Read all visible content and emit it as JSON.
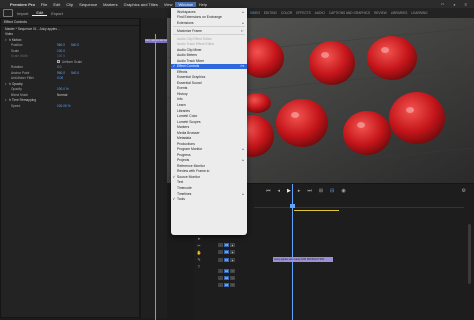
{
  "menubar": {
    "app": "Premiere Pro",
    "items": [
      "File",
      "Edit",
      "Clip",
      "Sequence",
      "Markers",
      "Graphics and Titles",
      "View",
      "Window",
      "Help"
    ],
    "active": "Window"
  },
  "workspace": {
    "tabs": [
      "Import",
      "Edit",
      "Export"
    ],
    "selected": "Edit",
    "right_tabs": [
      "VIDEO",
      "EDITING",
      "COLOR",
      "EFFECTS",
      "AUDIO",
      "CAPTIONS AND GRAPHICS",
      "REVIEW",
      "LIBRARIES",
      "LEARNING"
    ],
    "right_selected": "VIDEO"
  },
  "effect_controls": {
    "tab": "Effect Controls",
    "sequence_label": "Master * Sequence 01 - Juicy apples ...",
    "rows": [
      {
        "label": "Video",
        "value": "",
        "kind": "header"
      },
      {
        "label": "fx Motion",
        "value": "",
        "kind": "header"
      },
      {
        "label": "Position",
        "value": "960.0",
        "value2": "540.0",
        "kind": "param"
      },
      {
        "label": "Scale",
        "value": "100.0",
        "kind": "param"
      },
      {
        "label": "Scale Width",
        "value": "100.0",
        "kind": "param"
      },
      {
        "label": "",
        "value": "Uniform Scale",
        "kind": "check"
      },
      {
        "label": "Rotation",
        "value": "0.0",
        "kind": "param"
      },
      {
        "label": "Anchor Point",
        "value": "960.0",
        "value2": "540.0",
        "kind": "param"
      },
      {
        "label": "Anti-flicker Filter",
        "value": "0.00",
        "kind": "param"
      },
      {
        "label": "fx Opacity",
        "value": "",
        "kind": "header"
      },
      {
        "label": "Opacity",
        "value": "100.0 %",
        "kind": "param"
      },
      {
        "label": "Blend Mode",
        "value": "Normal",
        "kind": "param"
      },
      {
        "label": "fx Time Remapping",
        "value": "",
        "kind": "header"
      },
      {
        "label": "Speed",
        "value": "100.00 %",
        "kind": "param"
      }
    ],
    "clip_name": "Juicy apples are ready..."
  },
  "window_menu": {
    "items": [
      {
        "label": "Workspaces",
        "arrow": true
      },
      {
        "label": "Find Extensions on Exchange"
      },
      {
        "label": "Extensions",
        "arrow": true
      },
      {
        "sep": true
      },
      {
        "label": "Maximize Frame",
        "shortcut": "⇧`"
      },
      {
        "sep": true
      },
      {
        "label": "Audio Clip Effect Editor",
        "disabled": true
      },
      {
        "label": "Audio Track Effect Editor",
        "disabled": true
      },
      {
        "label": "Audio Clip Mixer"
      },
      {
        "label": "Audio Meters"
      },
      {
        "label": "Audio Track Mixer"
      },
      {
        "label": "Effect Controls",
        "checked": true,
        "highlighted": true,
        "shortcut": "⇧5"
      },
      {
        "label": "Effects"
      },
      {
        "label": "Essential Graphics"
      },
      {
        "label": "Essential Sound"
      },
      {
        "label": "Events"
      },
      {
        "label": "History"
      },
      {
        "label": "Info"
      },
      {
        "label": "Learn"
      },
      {
        "label": "Libraries"
      },
      {
        "label": "Lumetri Color"
      },
      {
        "label": "Lumetri Scopes"
      },
      {
        "label": "Markers"
      },
      {
        "label": "Media Browser"
      },
      {
        "label": "Metadata"
      },
      {
        "label": "Productions"
      },
      {
        "label": "Program Monitor",
        "arrow": true
      },
      {
        "label": "Progress"
      },
      {
        "label": "Projects",
        "arrow": true
      },
      {
        "label": "Reference Monitor"
      },
      {
        "label": "Review with Frame.io"
      },
      {
        "label": "Source Monitor",
        "checked": true
      },
      {
        "label": "Text"
      },
      {
        "label": "Timecode"
      },
      {
        "label": "Timelines",
        "arrow": true
      },
      {
        "label": "Tools",
        "checked": true
      }
    ]
  },
  "timeline": {
    "clip_label": "Juicy apples are ready FOR PRODUCTION",
    "tracks": [
      "V3",
      "V2",
      "V1",
      "A1",
      "A2",
      "A3"
    ]
  },
  "colors": {
    "highlight": "#2f67dd",
    "accent": "#5fa3ff",
    "clip": "#9b8fd8"
  }
}
